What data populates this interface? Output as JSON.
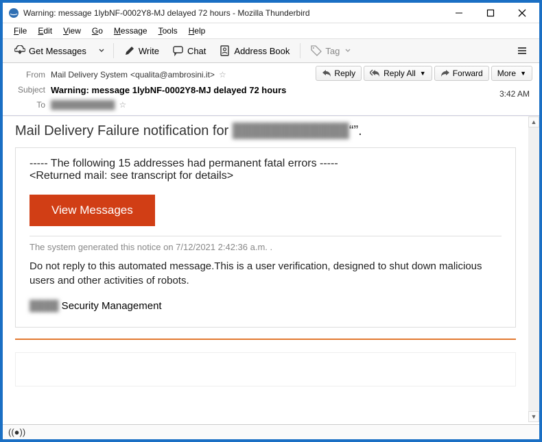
{
  "window": {
    "title": "Warning: message 1lybNF-0002Y8-MJ delayed 72 hours - Mozilla Thunderbird"
  },
  "menu": {
    "file": "File",
    "edit": "Edit",
    "view": "View",
    "go": "Go",
    "message": "Message",
    "tools": "Tools",
    "help": "Help"
  },
  "toolbar": {
    "get_messages": "Get Messages",
    "write": "Write",
    "chat": "Chat",
    "address_book": "Address Book",
    "tag": "Tag"
  },
  "headers": {
    "from_label": "From",
    "from_name": "Mail Delivery System",
    "from_email": "<qualita@ambrosini.it>",
    "subject_label": "Subject",
    "subject_value": "Warning: message 1lybNF-0002Y8-MJ delayed 72 hours",
    "to_label": "To",
    "to_value": "███████████",
    "time": "3:42 AM"
  },
  "actions": {
    "reply": "Reply",
    "reply_all": "Reply All",
    "forward": "Forward",
    "more": "More"
  },
  "body": {
    "title_prefix": "Mail Delivery Failure notification for ",
    "title_blur": "████████████",
    "title_suffix": "“”.",
    "fatal_line1": "----- The following 15 addresses had permanent fatal errors -----",
    "fatal_line2": "<Returned mail: see transcript for details>",
    "view_messages": "View Messages",
    "generated_notice": "The system generated this notice on 7/12/2021 2:42:36 a.m. .",
    "noreply": "Do not reply to this automated message.This is a user verification, designed to shut down malicious users and other  activities of  robots.",
    "sec_blur": "████",
    "sec_label": " Security Management"
  }
}
